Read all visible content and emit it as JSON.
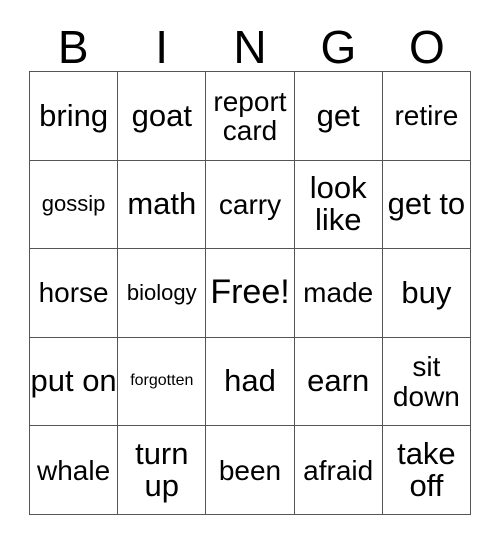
{
  "card": {
    "title": "BINGO",
    "header_letters": [
      "B",
      "I",
      "N",
      "G",
      "O"
    ],
    "free_space_label": "Free!",
    "colors": {
      "background": "#ffffff",
      "text": "#000000",
      "grid_line": "#555555"
    },
    "rows": [
      [
        {
          "text": "bring",
          "size": "lg"
        },
        {
          "text": "goat",
          "size": "lg"
        },
        {
          "text": "report card",
          "size": "md"
        },
        {
          "text": "get",
          "size": "lg"
        },
        {
          "text": "retire",
          "size": "md"
        }
      ],
      [
        {
          "text": "gossip",
          "size": "sm"
        },
        {
          "text": "math",
          "size": "lg"
        },
        {
          "text": "carry",
          "size": "md"
        },
        {
          "text": "look like",
          "size": "lg"
        },
        {
          "text": "get to",
          "size": "lg"
        }
      ],
      [
        {
          "text": "horse",
          "size": "md"
        },
        {
          "text": "biology",
          "size": "sm"
        },
        {
          "text": "Free!",
          "size": "xl"
        },
        {
          "text": "made",
          "size": "md"
        },
        {
          "text": "buy",
          "size": "lg"
        }
      ],
      [
        {
          "text": "put on",
          "size": "lg"
        },
        {
          "text": "forgotten",
          "size": "xs"
        },
        {
          "text": "had",
          "size": "lg"
        },
        {
          "text": "earn",
          "size": "lg"
        },
        {
          "text": "sit down",
          "size": "md"
        }
      ],
      [
        {
          "text": "whale",
          "size": "md"
        },
        {
          "text": "turn up",
          "size": "lg"
        },
        {
          "text": "been",
          "size": "md"
        },
        {
          "text": "afraid",
          "size": "md"
        },
        {
          "text": "take off",
          "size": "lg"
        }
      ]
    ]
  }
}
